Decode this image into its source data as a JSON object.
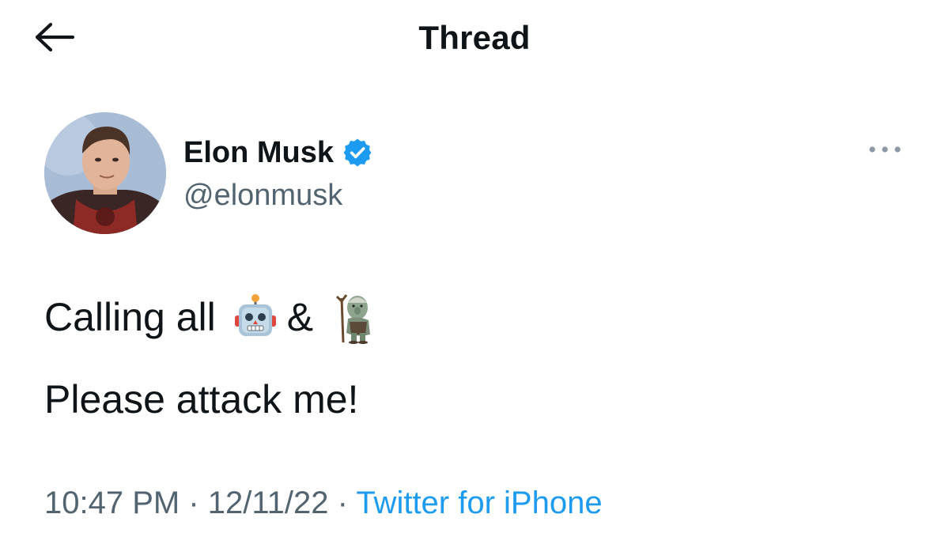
{
  "header": {
    "back_icon": "arrow-left-icon",
    "title": "Thread"
  },
  "author": {
    "name": "Elon Musk",
    "handle": "@elonmusk",
    "verified_icon": "verified-badge-icon",
    "verified_color": "#1d9bf0"
  },
  "more_icon": "more-horizontal-icon",
  "tweet": {
    "line1_text": "Calling all",
    "line1_emoji_1": "robot-emoji-icon",
    "line1_ampersand": "&",
    "line1_emoji_2": "troll-emoji-icon",
    "line2_text": "Please attack me!"
  },
  "meta": {
    "time": "10:47 PM",
    "sep1": " · ",
    "date": "12/11/22",
    "sep2": " · ",
    "source": "Twitter for iPhone"
  },
  "colors": {
    "text_primary": "#0f1419",
    "text_secondary": "#536471",
    "link": "#1d9bf0",
    "background": "#ffffff"
  }
}
